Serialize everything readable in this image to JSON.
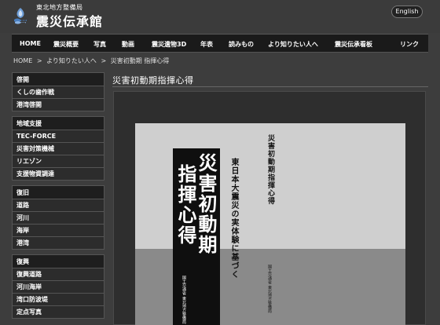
{
  "header": {
    "org": "東北地方整備局",
    "site_title": "震災伝承館",
    "lang_button": "English"
  },
  "nav": [
    "HOME",
    "震災概要",
    "写真",
    "動画",
    "震災遺物3D",
    "年表",
    "読みもの",
    "より知りたい人へ",
    "震災伝承看板",
    "リンク"
  ],
  "breadcrumb": [
    "HOME",
    ">",
    "より知りたい人へ",
    ">",
    "災害初動期 指揮心得"
  ],
  "sidebar": [
    {
      "head": "啓開",
      "items": [
        "くしの歯作戦",
        "港湾啓開"
      ]
    },
    {
      "head": "地域支援",
      "items": [
        "TEC-FORCE",
        "災害対策機械",
        "リエゾン",
        "支援物資調達"
      ]
    },
    {
      "head": "復旧",
      "items": [
        "道路",
        "河川",
        "海岸",
        "港湾"
      ]
    },
    {
      "head": "復興",
      "items": [
        "復興道路",
        "河川海岸",
        "湾口防波堤",
        "定点写真"
      ]
    }
  ],
  "page_heading": "災害初動期指揮心得",
  "book": {
    "title_line1": "災害初動期",
    "title_line2": "指揮心得",
    "subtitle": "東日本大震災の実体験に基づく",
    "spine_title": "災害初動期指揮心得",
    "publisher_front": "国土交通省 東北地方整備局",
    "publisher_spine": "国土交通省 東北地方整備局"
  }
}
